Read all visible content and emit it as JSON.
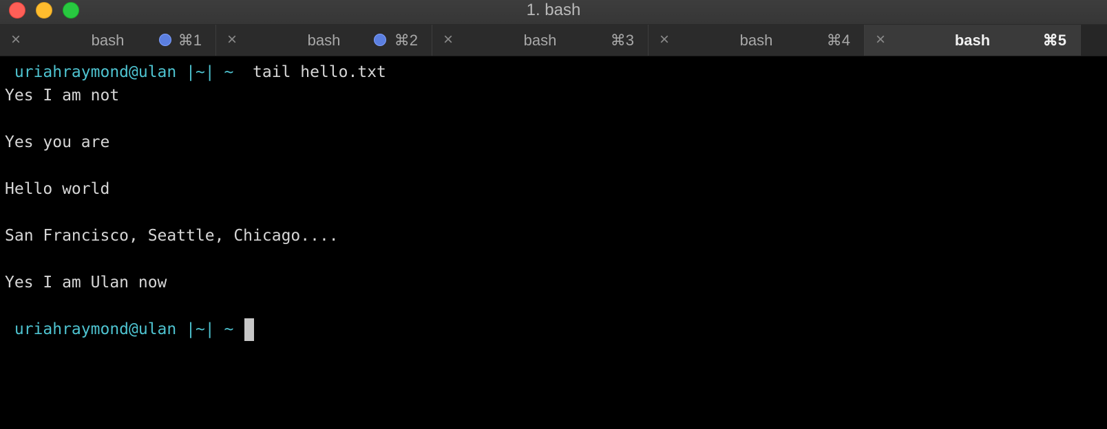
{
  "window": {
    "title": "1. bash"
  },
  "tabs": [
    {
      "label": "bash",
      "shortcut": "⌘1",
      "has_activity_dot": true,
      "active": false
    },
    {
      "label": "bash",
      "shortcut": "⌘2",
      "has_activity_dot": true,
      "active": false
    },
    {
      "label": "bash",
      "shortcut": "⌘3",
      "has_activity_dot": false,
      "active": false
    },
    {
      "label": "bash",
      "shortcut": "⌘4",
      "has_activity_dot": false,
      "active": false
    },
    {
      "label": "bash",
      "shortcut": "⌘5",
      "has_activity_dot": false,
      "active": true
    }
  ],
  "terminal": {
    "prompt": " uriahraymond@ulan |~| ~ ",
    "command": " tail hello.txt",
    "output": [
      "Yes I am not",
      "",
      "Yes you are",
      "",
      "Hello world",
      "",
      "San Francisco, Seattle, Chicago....",
      "",
      "Yes I am Ulan now",
      ""
    ],
    "final_prompt": " uriahraymond@ulan |~| ~ "
  },
  "colors": {
    "prompt": "#4ec3d0",
    "text": "#d6d6d6",
    "background": "#000000",
    "activity_dot": "#5b7fe0"
  },
  "icons": {
    "tab_close": "close-icon",
    "activity": "activity-dot-icon"
  }
}
